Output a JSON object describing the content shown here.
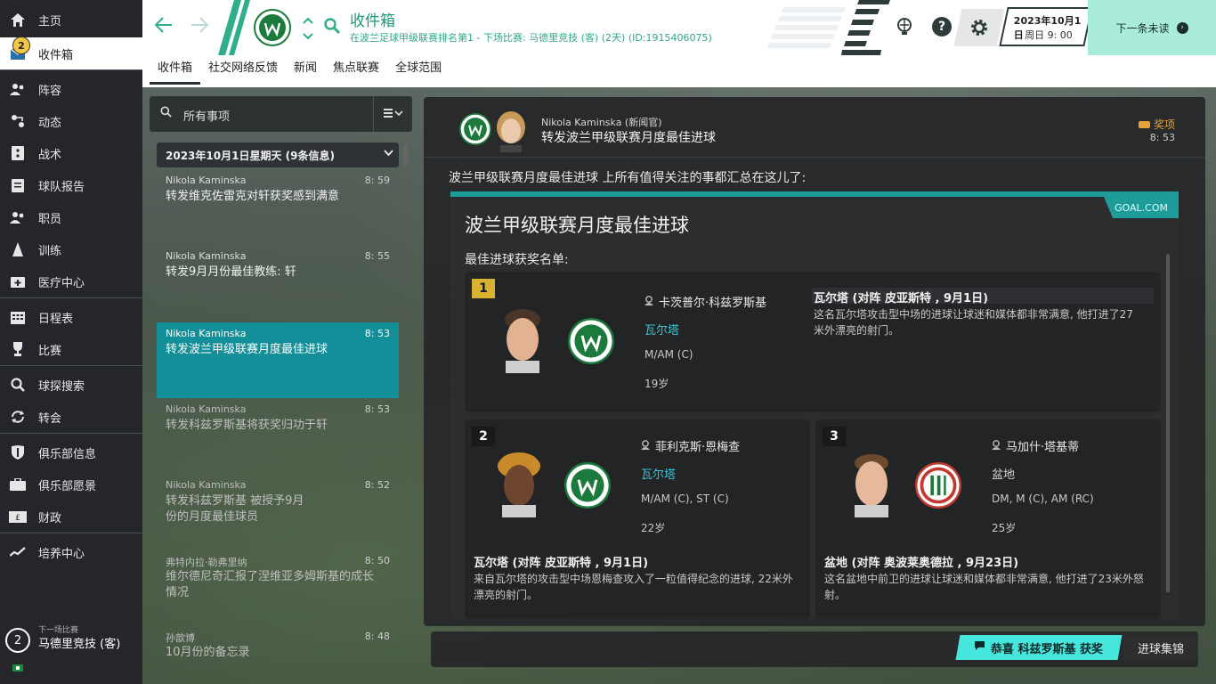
{
  "sidebar": {
    "items": [
      {
        "label": "主页",
        "icon": "home-icon"
      },
      {
        "label": "收件箱",
        "icon": "inbox-icon",
        "badge": "2",
        "active": true
      },
      {
        "label": "阵容",
        "icon": "squad-icon"
      },
      {
        "label": "动态",
        "icon": "dynamics-icon"
      },
      {
        "label": "战术",
        "icon": "tactics-icon"
      },
      {
        "label": "球队报告",
        "icon": "report-icon"
      },
      {
        "label": "职员",
        "icon": "staff-icon"
      },
      {
        "label": "训练",
        "icon": "training-icon"
      },
      {
        "label": "医疗中心",
        "icon": "medical-icon"
      },
      {
        "label": "日程表",
        "icon": "calendar-icon"
      },
      {
        "label": "比赛",
        "icon": "trophy-icon"
      },
      {
        "label": "球探搜索",
        "icon": "search-icon"
      },
      {
        "label": "转会",
        "icon": "transfer-icon"
      },
      {
        "label": "俱乐部信息",
        "icon": "shield-icon"
      },
      {
        "label": "俱乐部愿景",
        "icon": "briefcase-icon"
      },
      {
        "label": "财政",
        "icon": "finance-icon"
      },
      {
        "label": "培养中心",
        "icon": "development-icon"
      }
    ],
    "next_match": {
      "label": "下一场比赛",
      "opponent": "马德里竞技 (客)",
      "days": "2"
    }
  },
  "header": {
    "title": "收件箱",
    "subtitle": "在波兰足球甲级联赛排名第1 - 下场比赛: 马德里竞技 (客) (2天) (ID:1915406075)",
    "date": "2023年10月1日",
    "time": "周日 9: 00",
    "next_unread": "下一条未读"
  },
  "tabs": [
    "收件箱",
    "社交网络反馈",
    "新闻",
    "焦点联赛",
    "全球范围"
  ],
  "list": {
    "search_label": "所有事项",
    "date_group": "2023年10月1日星期天 (9条信息)",
    "messages": [
      {
        "sender": "Nikola Kaminska",
        "time": "8: 59",
        "subject": "转发维克佐雷克对轩获奖感到满意",
        "read": false
      },
      {
        "sender": "Nikola Kaminska",
        "time": "8: 55",
        "subject": "转发9月月份最佳教练: 轩",
        "read": false
      },
      {
        "sender": "Nikola Kaminska",
        "time": "8: 53",
        "subject": "转发波兰甲级联赛月度最佳进球",
        "read": false,
        "active": true
      },
      {
        "sender": "Nikola Kaminska",
        "time": "8: 53",
        "subject": "转发科兹罗斯基将获奖归功于轩",
        "read": true
      },
      {
        "sender": "Nikola Kaminska",
        "time": "8: 52",
        "subject": "转发科兹罗斯基 被授予9月份的月度最佳球员",
        "read": true
      },
      {
        "sender": "弗特内拉·勒弗里纳",
        "time": "8: 50",
        "subject": "维尔德尼奇汇报了涅维亚多姆斯基的成长情况",
        "read": true
      },
      {
        "sender": "孙歆博",
        "time": "8: 48",
        "subject": "10月份的备忘录",
        "read": true
      }
    ]
  },
  "message": {
    "sender": "Nikola Kaminska (新闻官)",
    "subject": "转发波兰甲级联赛月度最佳进球",
    "tag": "奖项",
    "time": "8: 53",
    "intro": "波兰甲级联赛月度最佳进球 上所有值得关注的事都汇总在这儿了:",
    "article": {
      "source": "GOAL.COM",
      "title": "波兰甲级联赛月度最佳进球",
      "subtitle": "最佳进球获奖名单:",
      "winners": [
        {
          "rank": "1",
          "name": "卡茨普尔·科兹罗斯基",
          "club": "瓦尔塔",
          "position": "M/AM (C)",
          "age": "19岁",
          "goal_head": "瓦尔塔 (对阵 皮亚斯特 , 9月1日)",
          "goal_desc": "这名瓦尔塔攻击型中场的进球让球迷和媒体都非常满意, 他打进了27米外漂亮的射门。"
        },
        {
          "rank": "2",
          "name": "菲利克斯·恩梅查",
          "club": "瓦尔塔",
          "position": "M/AM (C), ST (C)",
          "age": "22岁",
          "goal_head": "瓦尔塔 (对阵 皮亚斯特 , 9月1日)",
          "goal_desc": "来自瓦尔塔的攻击型中场恩梅查攻入了一粒值得纪念的进球, 22米外漂亮的射门。"
        },
        {
          "rank": "3",
          "name": "马加什·塔基蒂",
          "club": "盆地",
          "position": "DM, M (C), AM (RC)",
          "age": "25岁",
          "goal_head": "盆地 (对阵 奥波莱奥德拉 , 9月23日)",
          "goal_desc": "这名盆地中前卫的进球让球迷和媒体都非常满意, 他打进了23米外怒射。"
        }
      ]
    }
  },
  "actions": {
    "congratulate": "恭喜 科兹罗斯基 获奖",
    "goal_highlights": "进球集锦"
  },
  "colors": {
    "accent": "#138f9a",
    "header_green": "#1a9a78",
    "next_button": "#a8ecd9",
    "congrats": "#46e6dc",
    "gold": "#d9b232",
    "warta_green": "#1c7a3c",
    "zaglebie_red": "#c23a2e"
  }
}
